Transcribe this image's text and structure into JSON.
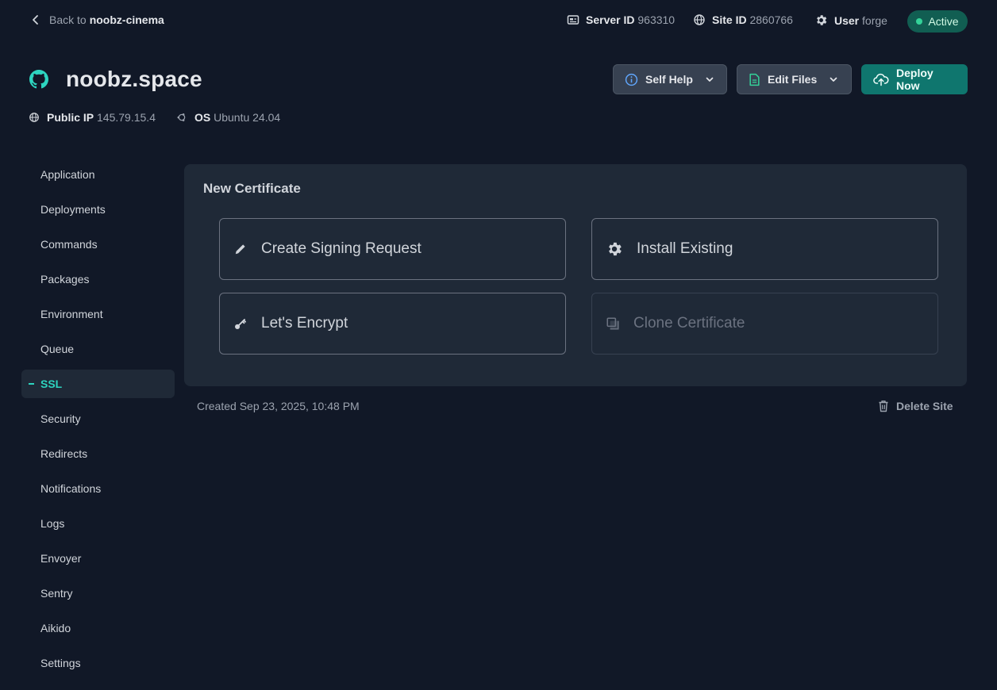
{
  "topbar": {
    "back_prefix": "Back to",
    "back_target": "noobz-cinema",
    "server_id_label": "Server ID",
    "server_id_value": "963310",
    "site_id_label": "Site ID",
    "site_id_value": "2860766",
    "user_label": "User",
    "user_value": "forge",
    "status": "Active"
  },
  "site": {
    "title": "noobz.space",
    "public_ip_label": "Public IP",
    "public_ip_value": "145.79.15.4",
    "os_label": "OS",
    "os_value": "Ubuntu 24.04"
  },
  "header_buttons": {
    "self_help": "Self Help",
    "edit_files": "Edit Files",
    "deploy_now": "Deploy Now"
  },
  "sidebar": {
    "items": [
      {
        "label": "Application"
      },
      {
        "label": "Deployments"
      },
      {
        "label": "Commands"
      },
      {
        "label": "Packages"
      },
      {
        "label": "Environment"
      },
      {
        "label": "Queue"
      },
      {
        "label": "SSL"
      },
      {
        "label": "Security"
      },
      {
        "label": "Redirects"
      },
      {
        "label": "Notifications"
      },
      {
        "label": "Logs"
      },
      {
        "label": "Envoyer"
      },
      {
        "label": "Sentry"
      },
      {
        "label": "Aikido"
      },
      {
        "label": "Settings"
      }
    ],
    "active_index": 6
  },
  "certificate": {
    "title": "New Certificate",
    "options": {
      "create_csr": "Create Signing Request",
      "install_existing": "Install Existing",
      "lets_encrypt": "Let's Encrypt",
      "clone": "Clone Certificate"
    }
  },
  "footer": {
    "created": "Created Sep 23, 2025, 10:48 PM",
    "delete": "Delete Site"
  },
  "colors": {
    "background": "#111827",
    "card": "#1f2937",
    "accent": "#2dd4bf",
    "deploy_button": "#0f766e",
    "status_badge": "#115e52"
  }
}
